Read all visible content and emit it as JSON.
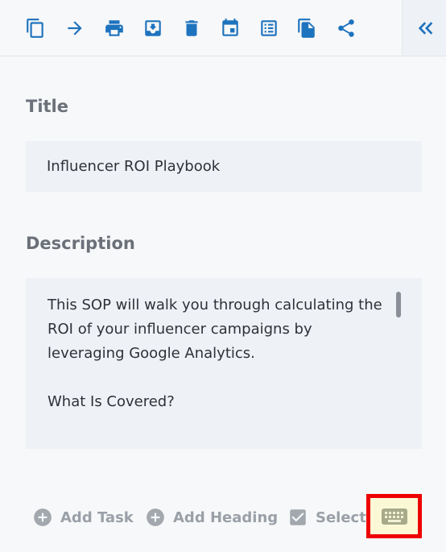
{
  "toolbar": {
    "icons": [
      "copy-icon",
      "arrow-right-icon",
      "print-icon",
      "archive-icon",
      "trash-icon",
      "calendar-icon",
      "list-icon",
      "file-copy-icon",
      "share-icon"
    ],
    "collapse_icon": "double-chevron-left-icon"
  },
  "title_section": {
    "label": "Title",
    "value": "Influencer ROI Playbook"
  },
  "description_section": {
    "label": "Description",
    "text": "This SOP will walk you through calculating the ROI of your influencer campaigns by leveraging Google Analytics.\n\nWhat Is Covered?"
  },
  "actions": {
    "add_task": "Add Task",
    "add_heading": "Add Heading",
    "select": "Select",
    "keyboard_icon": "keyboard-icon"
  },
  "colors": {
    "accent": "#1e73be",
    "highlight_border": "#ee0000",
    "highlight_fill": "#fbf8d6",
    "muted": "#9aa0a8"
  }
}
